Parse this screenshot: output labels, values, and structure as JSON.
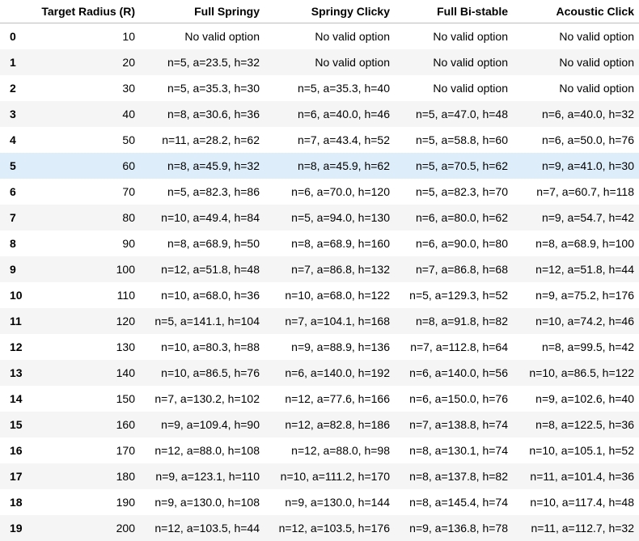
{
  "table": {
    "columns": [
      "",
      "Target Radius (R)",
      "Full Springy",
      "Springy Clicky",
      "Full Bi-stable",
      "Acoustic Click"
    ],
    "highlighted_row": 5,
    "highlight_color": "#ddeefa",
    "stripe_color": "#f5f5f5",
    "rows": [
      [
        "0",
        "10",
        "No valid option",
        "No valid option",
        "No valid option",
        "No valid option"
      ],
      [
        "1",
        "20",
        "n=5, a=23.5, h=32",
        "No valid option",
        "No valid option",
        "No valid option"
      ],
      [
        "2",
        "30",
        "n=5, a=35.3, h=30",
        "n=5, a=35.3, h=40",
        "No valid option",
        "No valid option"
      ],
      [
        "3",
        "40",
        "n=8, a=30.6, h=36",
        "n=6, a=40.0, h=46",
        "n=5, a=47.0, h=48",
        "n=6, a=40.0, h=32"
      ],
      [
        "4",
        "50",
        "n=11, a=28.2, h=62",
        "n=7, a=43.4, h=52",
        "n=5, a=58.8, h=60",
        "n=6, a=50.0, h=76"
      ],
      [
        "5",
        "60",
        "n=8, a=45.9, h=32",
        "n=8, a=45.9, h=62",
        "n=5, a=70.5, h=62",
        "n=9, a=41.0, h=30"
      ],
      [
        "6",
        "70",
        "n=5, a=82.3, h=86",
        "n=6, a=70.0, h=120",
        "n=5, a=82.3, h=70",
        "n=7, a=60.7, h=118"
      ],
      [
        "7",
        "80",
        "n=10, a=49.4, h=84",
        "n=5, a=94.0, h=130",
        "n=6, a=80.0, h=62",
        "n=9, a=54.7, h=42"
      ],
      [
        "8",
        "90",
        "n=8, a=68.9, h=50",
        "n=8, a=68.9, h=160",
        "n=6, a=90.0, h=80",
        "n=8, a=68.9, h=100"
      ],
      [
        "9",
        "100",
        "n=12, a=51.8, h=48",
        "n=7, a=86.8, h=132",
        "n=7, a=86.8, h=68",
        "n=12, a=51.8, h=44"
      ],
      [
        "10",
        "110",
        "n=10, a=68.0, h=36",
        "n=10, a=68.0, h=122",
        "n=5, a=129.3, h=52",
        "n=9, a=75.2, h=176"
      ],
      [
        "11",
        "120",
        "n=5, a=141.1, h=104",
        "n=7, a=104.1, h=168",
        "n=8, a=91.8, h=82",
        "n=10, a=74.2, h=46"
      ],
      [
        "12",
        "130",
        "n=10, a=80.3, h=88",
        "n=9, a=88.9, h=136",
        "n=7, a=112.8, h=64",
        "n=8, a=99.5, h=42"
      ],
      [
        "13",
        "140",
        "n=10, a=86.5, h=76",
        "n=6, a=140.0, h=192",
        "n=6, a=140.0, h=56",
        "n=10, a=86.5, h=122"
      ],
      [
        "14",
        "150",
        "n=7, a=130.2, h=102",
        "n=12, a=77.6, h=166",
        "n=6, a=150.0, h=76",
        "n=9, a=102.6, h=40"
      ],
      [
        "15",
        "160",
        "n=9, a=109.4, h=90",
        "n=12, a=82.8, h=186",
        "n=7, a=138.8, h=74",
        "n=8, a=122.5, h=36"
      ],
      [
        "16",
        "170",
        "n=12, a=88.0, h=108",
        "n=12, a=88.0, h=98",
        "n=8, a=130.1, h=74",
        "n=10, a=105.1, h=52"
      ],
      [
        "17",
        "180",
        "n=9, a=123.1, h=110",
        "n=10, a=111.2, h=170",
        "n=8, a=137.8, h=82",
        "n=11, a=101.4, h=36"
      ],
      [
        "18",
        "190",
        "n=9, a=130.0, h=108",
        "n=9, a=130.0, h=144",
        "n=8, a=145.4, h=74",
        "n=10, a=117.4, h=48"
      ],
      [
        "19",
        "200",
        "n=12, a=103.5, h=44",
        "n=12, a=103.5, h=176",
        "n=9, a=136.8, h=78",
        "n=11, a=112.7, h=32"
      ]
    ]
  }
}
